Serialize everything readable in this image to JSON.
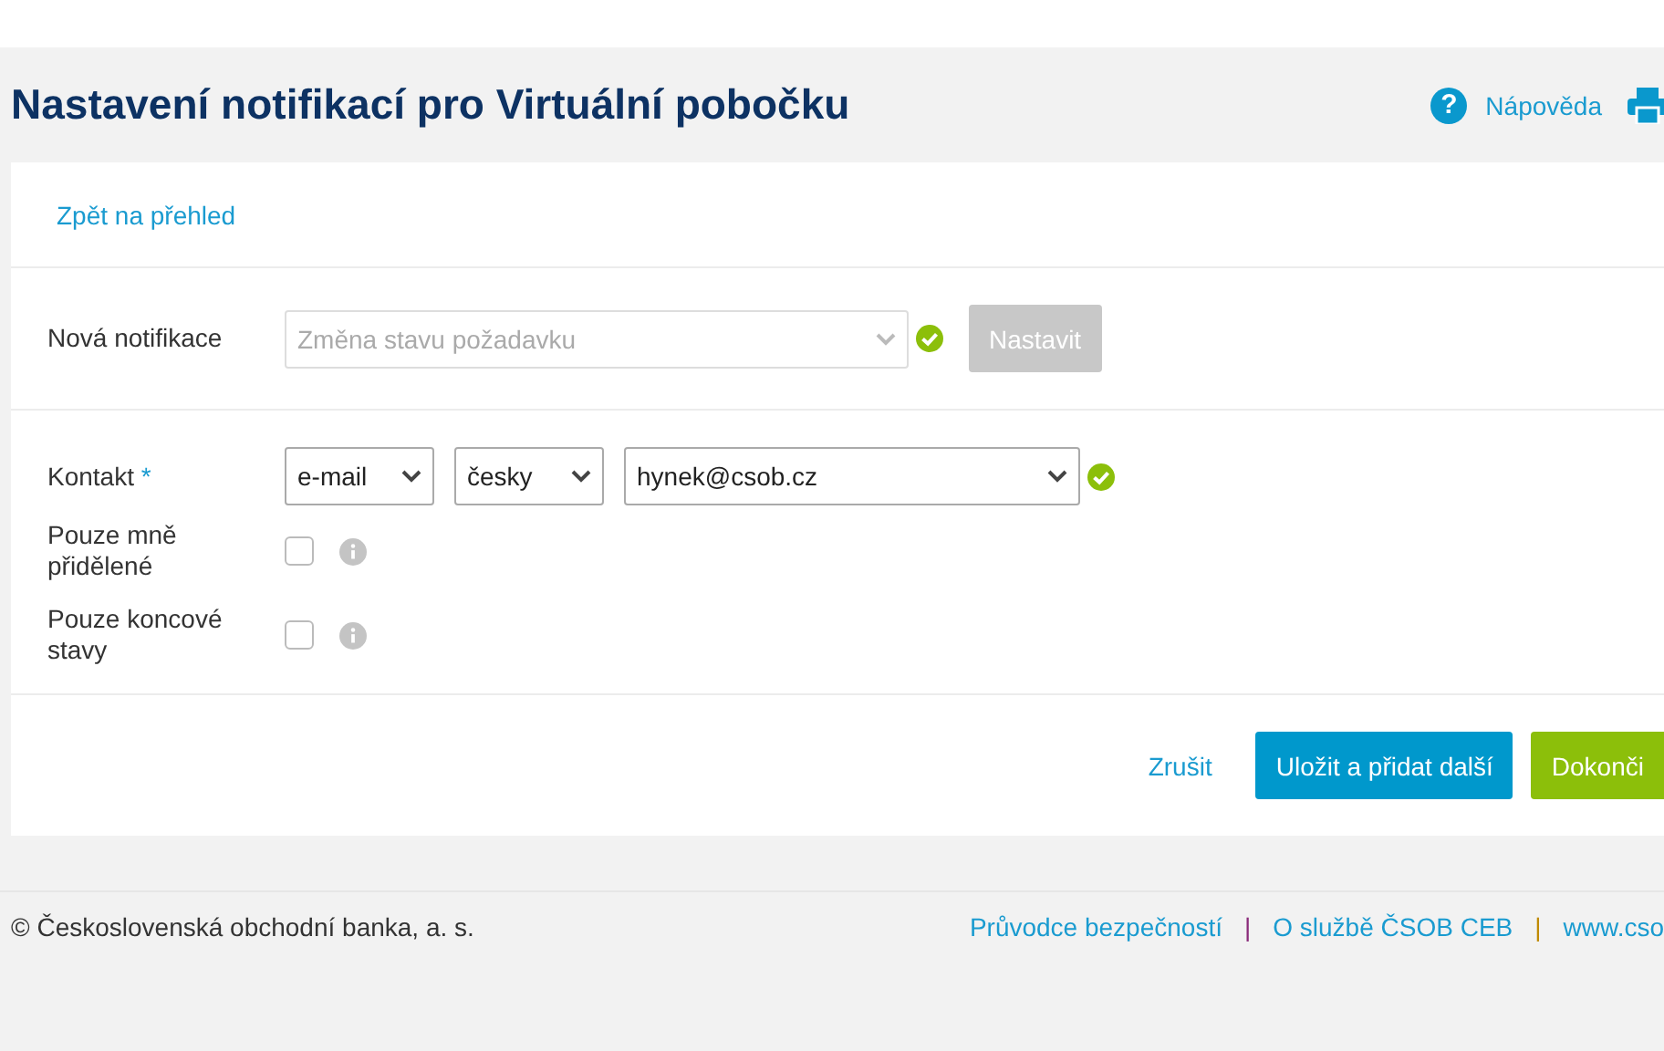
{
  "header": {
    "title": "Nastavení notifikací pro Virtuální pobočku",
    "help_icon": "?",
    "help_link": "Nápověda"
  },
  "back_link": "Zpět na přehled",
  "new_notification": {
    "label": "Nová notifikace",
    "placeholder": "Změna stavu požadavku",
    "valid": true,
    "button": {
      "label": "Nastavit",
      "disabled": true
    }
  },
  "contact": {
    "label": "Kontakt",
    "required_mark": "*",
    "type": "e-mail",
    "language": "česky",
    "address": "hynek@csob.cz",
    "valid": true
  },
  "options": [
    {
      "label": "Pouze mně přidělené",
      "checked": false
    },
    {
      "label": "Pouze koncové stavy",
      "checked": false
    }
  ],
  "actions": [
    {
      "label": "Zrušit",
      "kind": "link"
    },
    {
      "label": "Uložit a přidat další",
      "kind": "primary"
    },
    {
      "label": "Dokonči",
      "kind": "success"
    }
  ],
  "footer": {
    "copyright": "© Československá obchodní banka, a. s.",
    "links": [
      {
        "label": "Průvodce bezpečností",
        "separator": "|",
        "color": "#8a2a7a"
      },
      {
        "label": "O službě ČSOB CEB",
        "separator": "|",
        "color": "#c08a00"
      },
      {
        "label": "www.cso"
      }
    ]
  }
}
